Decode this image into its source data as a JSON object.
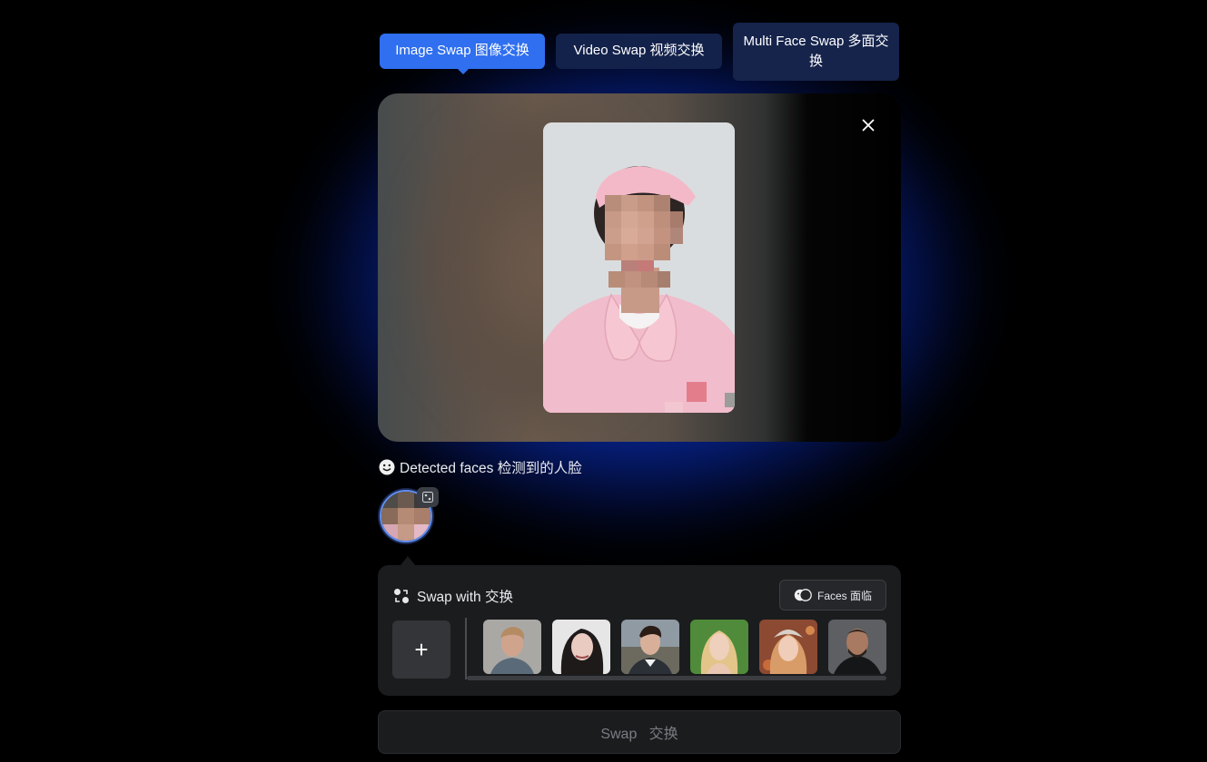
{
  "tabs": [
    {
      "label": "Image Swap 图像交换",
      "active": true
    },
    {
      "label": "Video Swap 视频交换",
      "active": false
    },
    {
      "label": "Multi Face Swap 多面交换",
      "active": false
    }
  ],
  "preview": {
    "close_icon": "close-icon"
  },
  "detected": {
    "label": "Detected faces 检测到的人脸",
    "icon": "smile-icon"
  },
  "swap_with": {
    "title": "Swap with 交换",
    "faces_button": "Faces 面临",
    "add_label": "+",
    "faces": [
      {
        "name": "face-1"
      },
      {
        "name": "face-2"
      },
      {
        "name": "face-3"
      },
      {
        "name": "face-4"
      },
      {
        "name": "face-5"
      },
      {
        "name": "face-6"
      }
    ]
  },
  "action": {
    "swap_label": "Swap   交换"
  },
  "colors": {
    "accent": "#2f6ff0",
    "tab_idle": "#13224a",
    "panel": "#1b1c1e"
  }
}
